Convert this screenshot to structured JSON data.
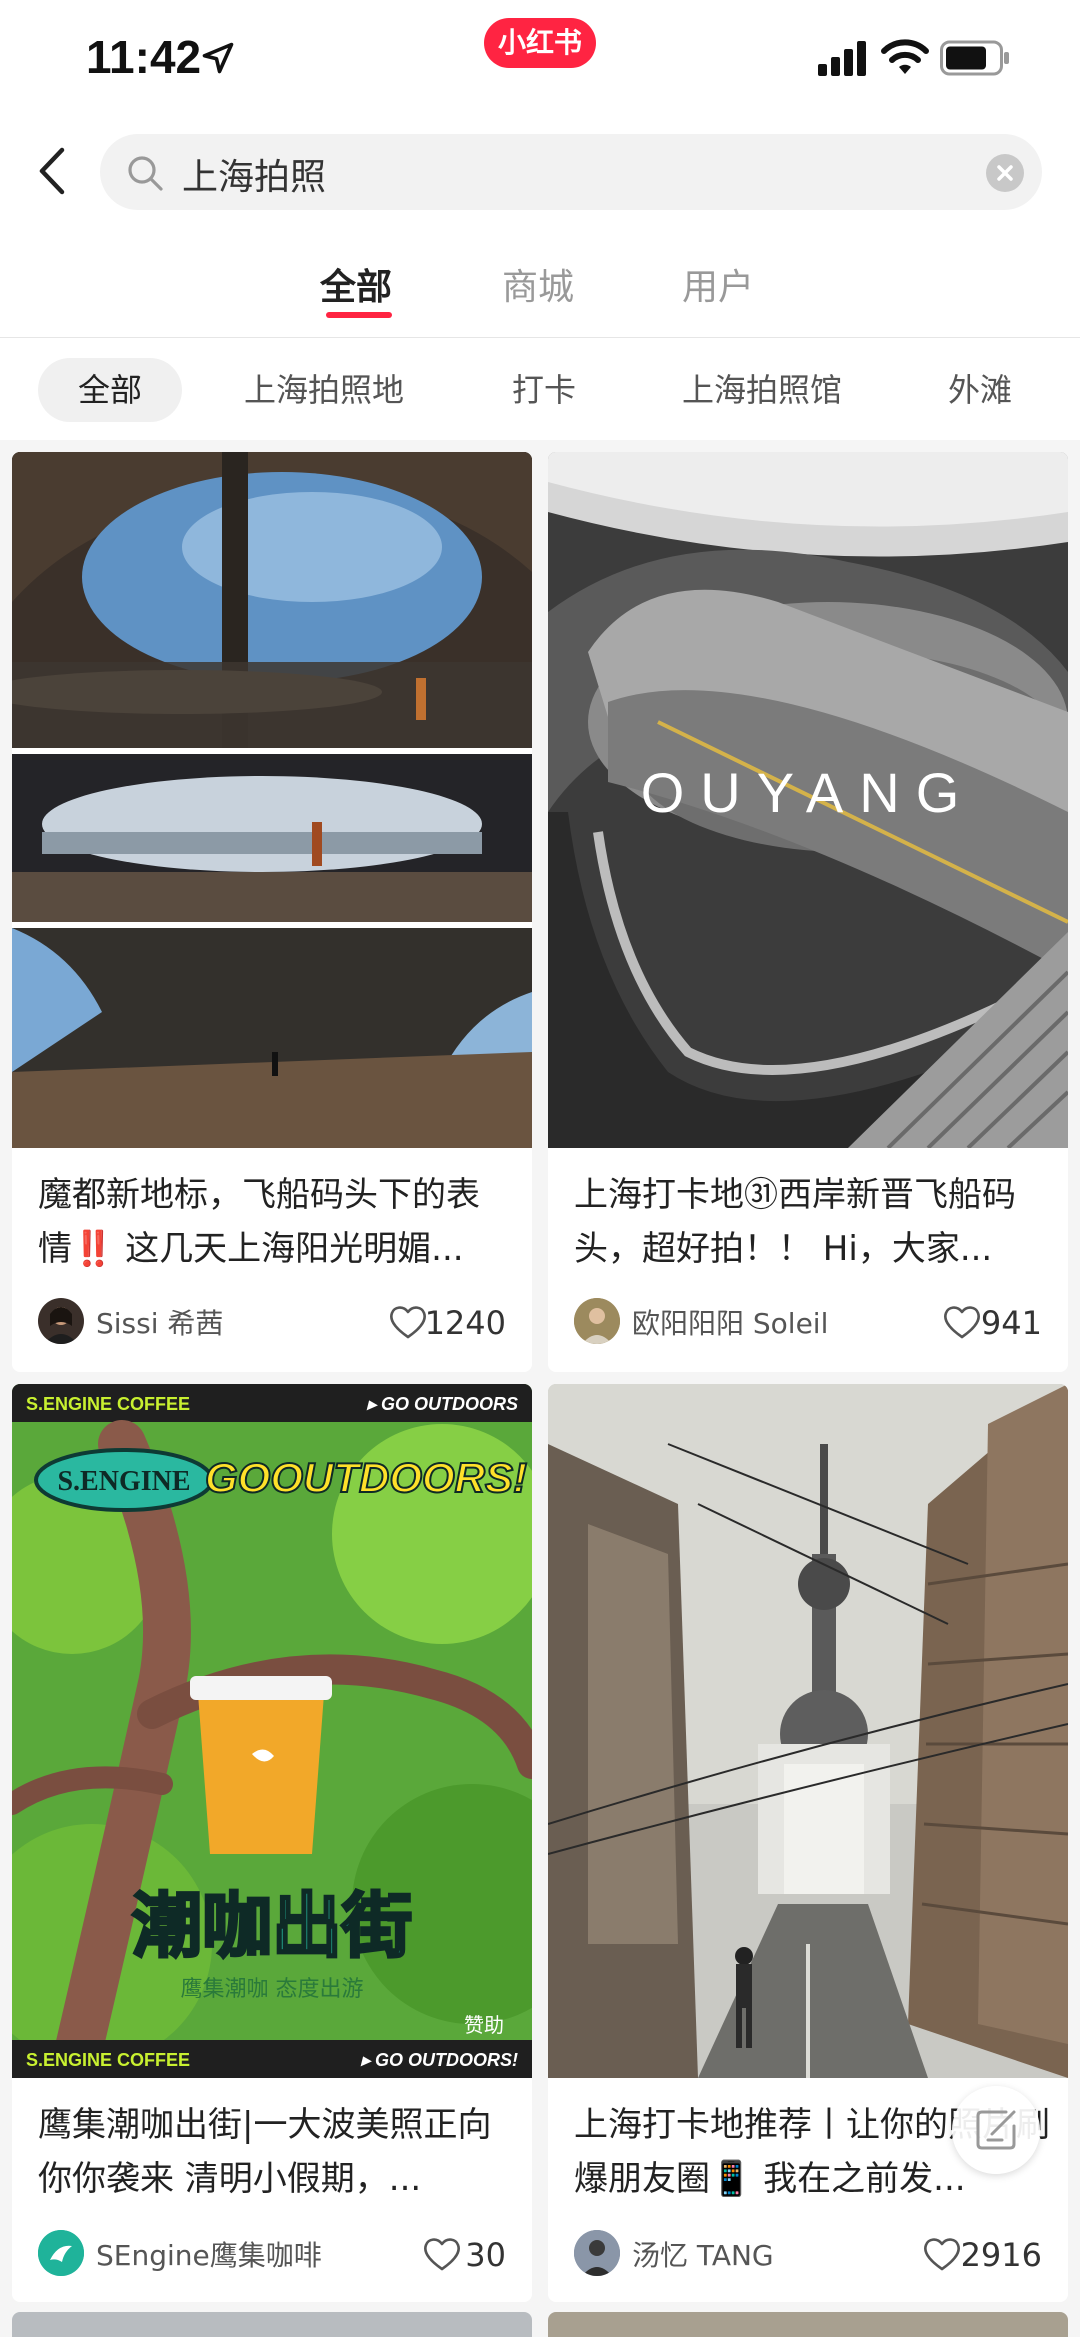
{
  "status_bar": {
    "time": "11:42",
    "app_badge": "小红书"
  },
  "search": {
    "query": "上海拍照"
  },
  "tabs": [
    {
      "label": "全部",
      "active": true
    },
    {
      "label": "商城",
      "active": false
    },
    {
      "label": "用户",
      "active": false
    }
  ],
  "chips": [
    "全部",
    "上海拍照地",
    "打卡",
    "上海拍照馆",
    "外滩"
  ],
  "cards": [
    {
      "title": "魔都新地标，飞船码头下的表情‼️ 这几天上海阳光明媚...",
      "author": "Sissi 希茜",
      "likes": "1240"
    },
    {
      "title": "上海打卡地㉛西岸新晋飞船码头，超好拍！！ Hi，大家...",
      "author": "欧阳阳阳 Soleil",
      "likes": "941",
      "overlay_text": "OUYANG"
    },
    {
      "title": "鹰集潮咖出街|一大波美照正向你你袭来 清明小假期，...",
      "author": "SEngine鹰集咖啡",
      "likes": "30",
      "ad": {
        "top_left": "S.ENGINE COFFEE",
        "top_right": "▸ GO OUTDOORS",
        "brand": "S.ENGINE",
        "slogan": "GOOUTDOORS!",
        "headline": "潮咖出街",
        "sub": "鹰集潮咖 态度出游",
        "sponsor": "赞助",
        "bottom_left": "S.ENGINE COFFEE",
        "bottom_right": "▸ GO OUTDOORS!"
      }
    },
    {
      "title": "上海打卡地推荐丨让你的照片刷爆朋友圈📱 我在之前发...",
      "author": "汤忆 TANG",
      "likes": "2916"
    }
  ],
  "colors": {
    "accent": "#ff2442",
    "background": "#f5f5f5",
    "card": "#ffffff"
  }
}
